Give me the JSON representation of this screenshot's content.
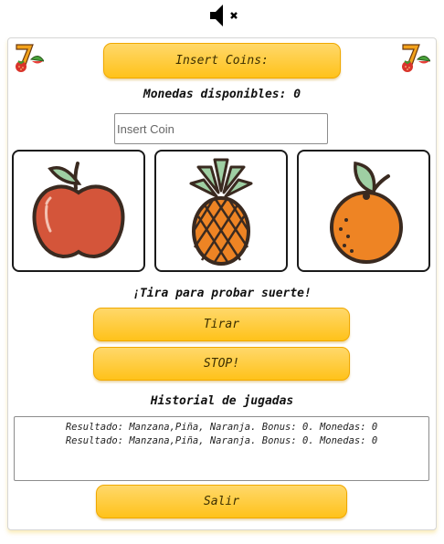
{
  "sound": {
    "icon": "mute-speaker-icon"
  },
  "header": {
    "insert_coins_label": "Insert Coins:",
    "coins_text": "Monedas disponibles: 0",
    "logo_icon": "slot-seven-fruit-icon"
  },
  "coin_input": {
    "placeholder": "Insert Coin",
    "value": ""
  },
  "reels": [
    {
      "fruit": "Manzana",
      "icon": "apple-icon"
    },
    {
      "fruit": "Piña",
      "icon": "pineapple-icon"
    },
    {
      "fruit": "Naranja",
      "icon": "orange-icon"
    }
  ],
  "prompt": "¡Tira para probar suerte!",
  "buttons": {
    "spin": "Tirar",
    "stop": "STOP!",
    "exit": "Salir"
  },
  "history": {
    "title": "Historial de jugadas",
    "entries": [
      "Resultado: Manzana,Piña, Naranja. Bonus: 0. Monedas: 0",
      "Resultado: Manzana,Piña, Naranja. Bonus: 0. Monedas: 0"
    ]
  },
  "colors": {
    "button": "#ffc21a",
    "button_border": "#f0a800",
    "apple": "#d4553a",
    "orange": "#ee8424"
  }
}
